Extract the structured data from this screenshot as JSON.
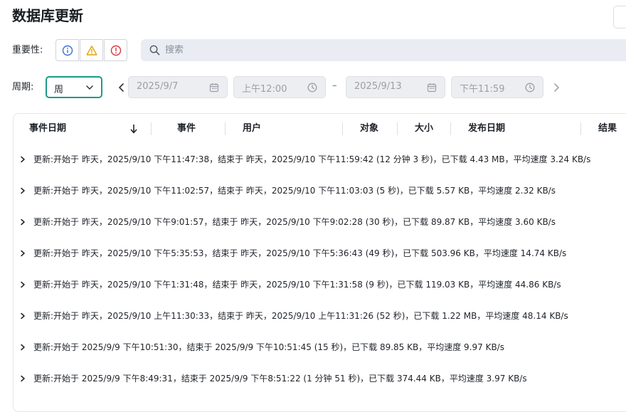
{
  "page": {
    "title": "数据库更新"
  },
  "filters": {
    "severity_label": "重要性:",
    "search_placeholder": "搜索",
    "period_label": "周期:",
    "period_value": "周",
    "start_date": "2025/9/7",
    "start_time": "上午12:00",
    "range_separator": "–",
    "end_date": "2025/9/13",
    "end_time": "下午11:59"
  },
  "icons": {
    "severity_info": "info-circle-icon",
    "severity_warning": "warning-triangle-icon",
    "severity_error": "error-circle-icon",
    "search": "search-icon",
    "period_dropdown": "chevron-down-icon",
    "prev": "chevron-left-icon",
    "next": "chevron-right-icon",
    "calendar": "calendar-icon",
    "clock": "clock-icon",
    "sort": "arrow-down-icon",
    "expand": "chevron-right-icon"
  },
  "colors": {
    "accent": "#1a9b88",
    "info": "#3b6fd8",
    "warning": "#e0a400",
    "error": "#d9363e"
  },
  "table": {
    "columns": [
      "事件日期",
      "事件",
      "用户",
      "对象",
      "大小",
      "发布日期",
      "结果"
    ],
    "sort_indicator": "↓",
    "rows": [
      "更新:开始于 昨天，2025/9/10 下午11:47:38，结束于 昨天，2025/9/10 下午11:59:42 (12 分钟 3 秒)，已下载 4.43 MB，平均速度 3.24 KB/s",
      "更新:开始于 昨天，2025/9/10 下午11:02:57，结束于 昨天，2025/9/10 下午11:03:03 (5 秒)，已下载 5.57 KB，平均速度 2.32 KB/s",
      "更新:开始于 昨天，2025/9/10 下午9:01:57，结束于 昨天，2025/9/10 下午9:02:28 (30 秒)，已下载 89.87 KB，平均速度 3.60 KB/s",
      "更新:开始于 昨天，2025/9/10 下午5:35:53，结束于 昨天，2025/9/10 下午5:36:43 (49 秒)，已下载 503.96 KB，平均速度 14.74 KB/s",
      "更新:开始于 昨天，2025/9/10 下午1:31:48，结束于 昨天，2025/9/10 下午1:31:58 (9 秒)，已下载 119.03 KB，平均速度 44.86 KB/s",
      "更新:开始于 昨天，2025/9/10 上午11:30:33，结束于 昨天，2025/9/10 上午11:31:26 (52 秒)，已下载 1.22 MB，平均速度 48.14 KB/s",
      "更新:开始于 2025/9/9 下午10:51:30，结束于 2025/9/9 下午10:51:45 (15 秒)，已下载 89.85 KB，平均速度 9.97 KB/s",
      "更新:开始于 2025/9/9 下午8:49:31，结束于 2025/9/9 下午8:51:22 (1 分钟 51 秒)，已下载 374.44 KB，平均速度 3.97 KB/s"
    ]
  }
}
